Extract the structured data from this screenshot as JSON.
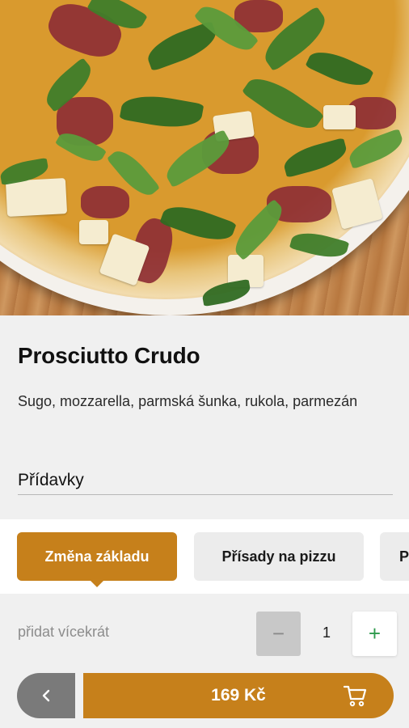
{
  "product": {
    "image_alt": "pizza-photo",
    "name": "Prosciutto Crudo",
    "description": "Sugo, mozzarella, parmská šunka, rukola, parmezán"
  },
  "addons": {
    "heading": "Přídavky"
  },
  "tabs": [
    {
      "label": "Změna základu",
      "active": true
    },
    {
      "label": "Přísady na pizzu",
      "active": false
    },
    {
      "label": "P",
      "active": false
    }
  ],
  "quantity": {
    "label": "přidat vícekrát",
    "minus_label": "−",
    "value": "1",
    "plus_label": "+"
  },
  "footer": {
    "back_icon": "chevron-left-icon",
    "price": "169 Kč",
    "cart_icon": "shopping-cart-icon"
  },
  "colors": {
    "accent": "#c6801b",
    "back_button": "#7a7a7a",
    "plus_icon": "#2e9a4d",
    "background": "#f0f0f0"
  }
}
